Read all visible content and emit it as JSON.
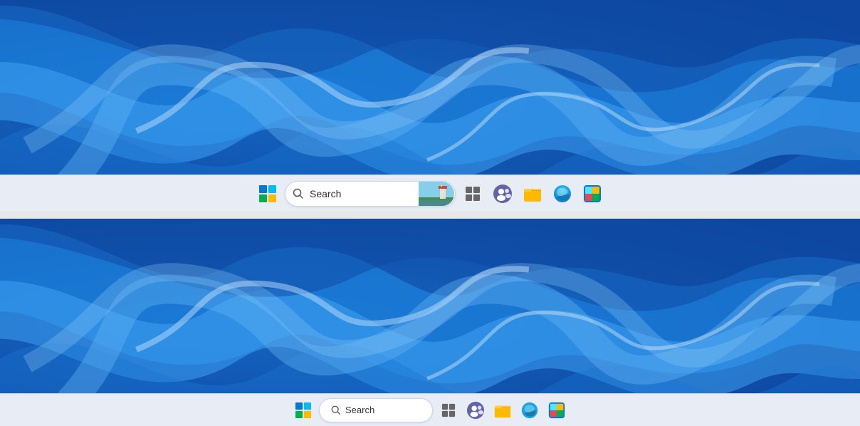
{
  "taskbars": [
    {
      "id": "top",
      "search_label": "Search",
      "icons": [
        {
          "name": "windows-logo",
          "label": "Start"
        },
        {
          "name": "search-bar",
          "label": "Search"
        },
        {
          "name": "task-view",
          "label": "Task View"
        },
        {
          "name": "teams-chat",
          "label": "Chat"
        },
        {
          "name": "file-explorer",
          "label": "File Explorer"
        },
        {
          "name": "edge-browser",
          "label": "Microsoft Edge"
        },
        {
          "name": "microsoft-store",
          "label": "Microsoft Store"
        }
      ]
    },
    {
      "id": "bottom",
      "search_label": "Search",
      "icons": [
        {
          "name": "windows-logo",
          "label": "Start"
        },
        {
          "name": "search-bar",
          "label": "Search"
        },
        {
          "name": "task-view",
          "label": "Task View"
        },
        {
          "name": "teams-chat",
          "label": "Chat"
        },
        {
          "name": "file-explorer",
          "label": "File Explorer"
        },
        {
          "name": "edge-browser",
          "label": "Microsoft Edge"
        },
        {
          "name": "microsoft-store",
          "label": "Microsoft Store"
        }
      ]
    }
  ],
  "colors": {
    "win_blue1": "#0ea5e9",
    "win_blue2": "#0078d4",
    "win_green": "#00b050",
    "win_red": "#e84a5f",
    "win_yellow": "#ffbe00",
    "taskbar_bg": "#e5eaf3",
    "wallpaper_dark": "#1a6abf",
    "wallpaper_mid": "#2e8fe0",
    "wallpaper_light": "#4aa8f8"
  }
}
